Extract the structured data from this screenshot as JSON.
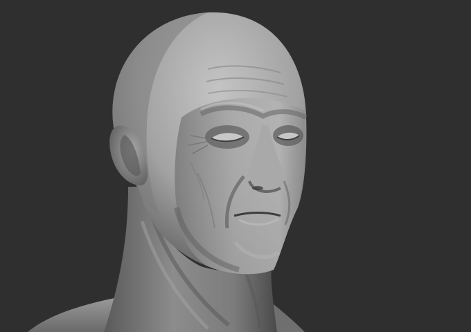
{
  "scene": {
    "subject": "sculpt-head-render",
    "colors": {
      "background": "#2f2f2f",
      "clay_light": "#b9b9b9",
      "clay_mid": "#8e8e8e",
      "clay_dark": "#4e4e4e",
      "clay_shadow": "#353535"
    }
  }
}
